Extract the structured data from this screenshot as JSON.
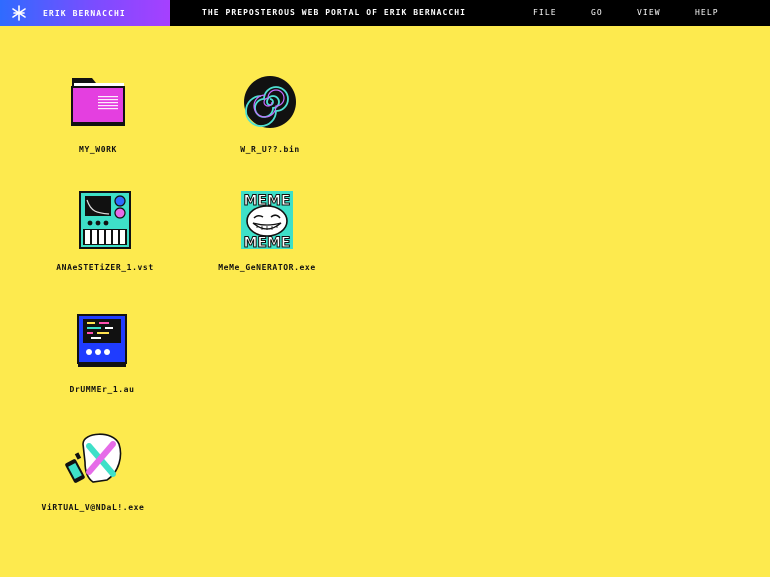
{
  "menubar": {
    "brand_name": "ERIK BERNACCHI",
    "site_title": "THE PREPOSTEROUS WEB PORTAL OF ERIK BERNACCHI",
    "menu": [
      "FILE",
      "GO",
      "VIEW",
      "HELP"
    ]
  },
  "desktop": {
    "icons": [
      {
        "label": "MY_W0RK",
        "icon": "folder-icon"
      },
      {
        "label": "W_R_U??.bin",
        "icon": "spiral-disc-icon"
      },
      {
        "label": "ANAeSTETiZER_1.vst",
        "icon": "synth-plugin-icon"
      },
      {
        "label": "MeMe_GeNERATOR.exe",
        "icon": "troll-face-meme-icon"
      },
      {
        "label": "DrUMMEr_1.au",
        "icon": "drum-machine-icon"
      },
      {
        "label": "ViRTUAL_V@NDaL!.exe",
        "icon": "spray-can-vandal-icon"
      }
    ]
  },
  "colors": {
    "desktop_bg": "#fdea4e",
    "menubar_bg": "#000000",
    "brand_gradient_start": "#2f6bff",
    "brand_gradient_end": "#a640ff"
  }
}
